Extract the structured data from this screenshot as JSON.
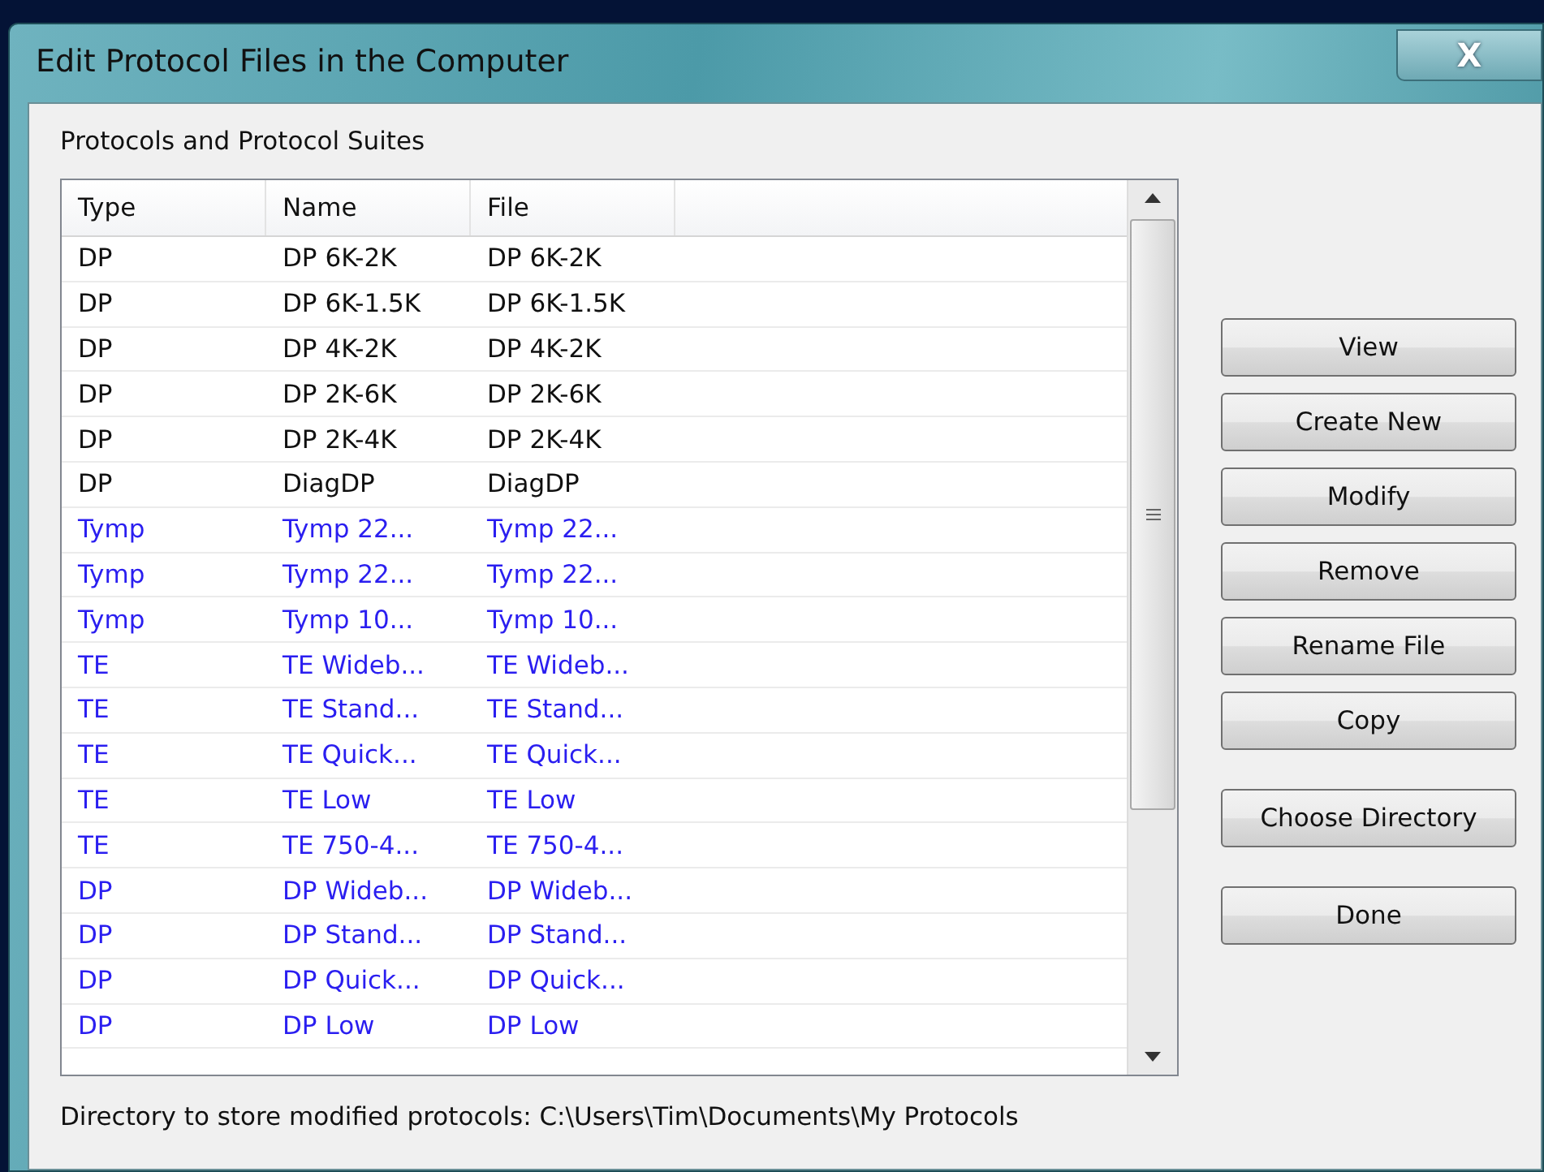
{
  "window": {
    "title": "Edit Protocol Files in the Computer",
    "close": "X"
  },
  "group_label": "Protocols and Protocol Suites",
  "table": {
    "columns": [
      "Type",
      "Name",
      "File"
    ],
    "rows": [
      {
        "type": "DP",
        "name": "DP 6K-2K",
        "file": "DP 6K-2K",
        "color": "#101010"
      },
      {
        "type": "DP",
        "name": "DP 6K-1.5K",
        "file": "DP 6K-1.5K",
        "color": "#101010"
      },
      {
        "type": "DP",
        "name": "DP 4K-2K",
        "file": "DP 4K-2K",
        "color": "#101010"
      },
      {
        "type": "DP",
        "name": "DP 2K-6K",
        "file": "DP 2K-6K",
        "color": "#101010"
      },
      {
        "type": "DP",
        "name": "DP 2K-4K",
        "file": "DP 2K-4K",
        "color": "#101010"
      },
      {
        "type": "DP",
        "name": "DiagDP",
        "file": "DiagDP",
        "color": "#101010"
      },
      {
        "type": "Tymp",
        "name": "Tymp 22...",
        "file": "Tymp 22...",
        "color": "#2a1ef0"
      },
      {
        "type": "Tymp",
        "name": "Tymp 22...",
        "file": "Tymp 22...",
        "color": "#2a1ef0"
      },
      {
        "type": "Tymp",
        "name": "Tymp 10...",
        "file": "Tymp 10...",
        "color": "#2a1ef0"
      },
      {
        "type": "TE",
        "name": "TE Wideb...",
        "file": "TE Wideb...",
        "color": "#2a1ef0"
      },
      {
        "type": "TE",
        "name": "TE Stand...",
        "file": "TE Stand...",
        "color": "#2a1ef0"
      },
      {
        "type": "TE",
        "name": "TE Quick...",
        "file": "TE Quick...",
        "color": "#2a1ef0"
      },
      {
        "type": "TE",
        "name": "TE Low",
        "file": "TE Low",
        "color": "#2a1ef0"
      },
      {
        "type": "TE",
        "name": "TE 750-4...",
        "file": "TE 750-4...",
        "color": "#2a1ef0"
      },
      {
        "type": "DP",
        "name": "DP Wideb...",
        "file": "DP Wideb...",
        "color": "#2a1ef0"
      },
      {
        "type": "DP",
        "name": "DP Stand...",
        "file": "DP Stand...",
        "color": "#2a1ef0"
      },
      {
        "type": "DP",
        "name": "DP Quick...",
        "file": "DP Quick...",
        "color": "#2a1ef0"
      },
      {
        "type": "DP",
        "name": "DP Low",
        "file": "DP Low",
        "color": "#2a1ef0"
      }
    ]
  },
  "button_groups": [
    [
      "View",
      "Create New",
      "Modify",
      "Remove",
      "Rename File",
      "Copy"
    ],
    [
      "Choose Directory"
    ],
    [
      "Done"
    ]
  ],
  "status": "Directory to store modified protocols: C:\\Users\\Tim\\Documents\\My Protocols"
}
